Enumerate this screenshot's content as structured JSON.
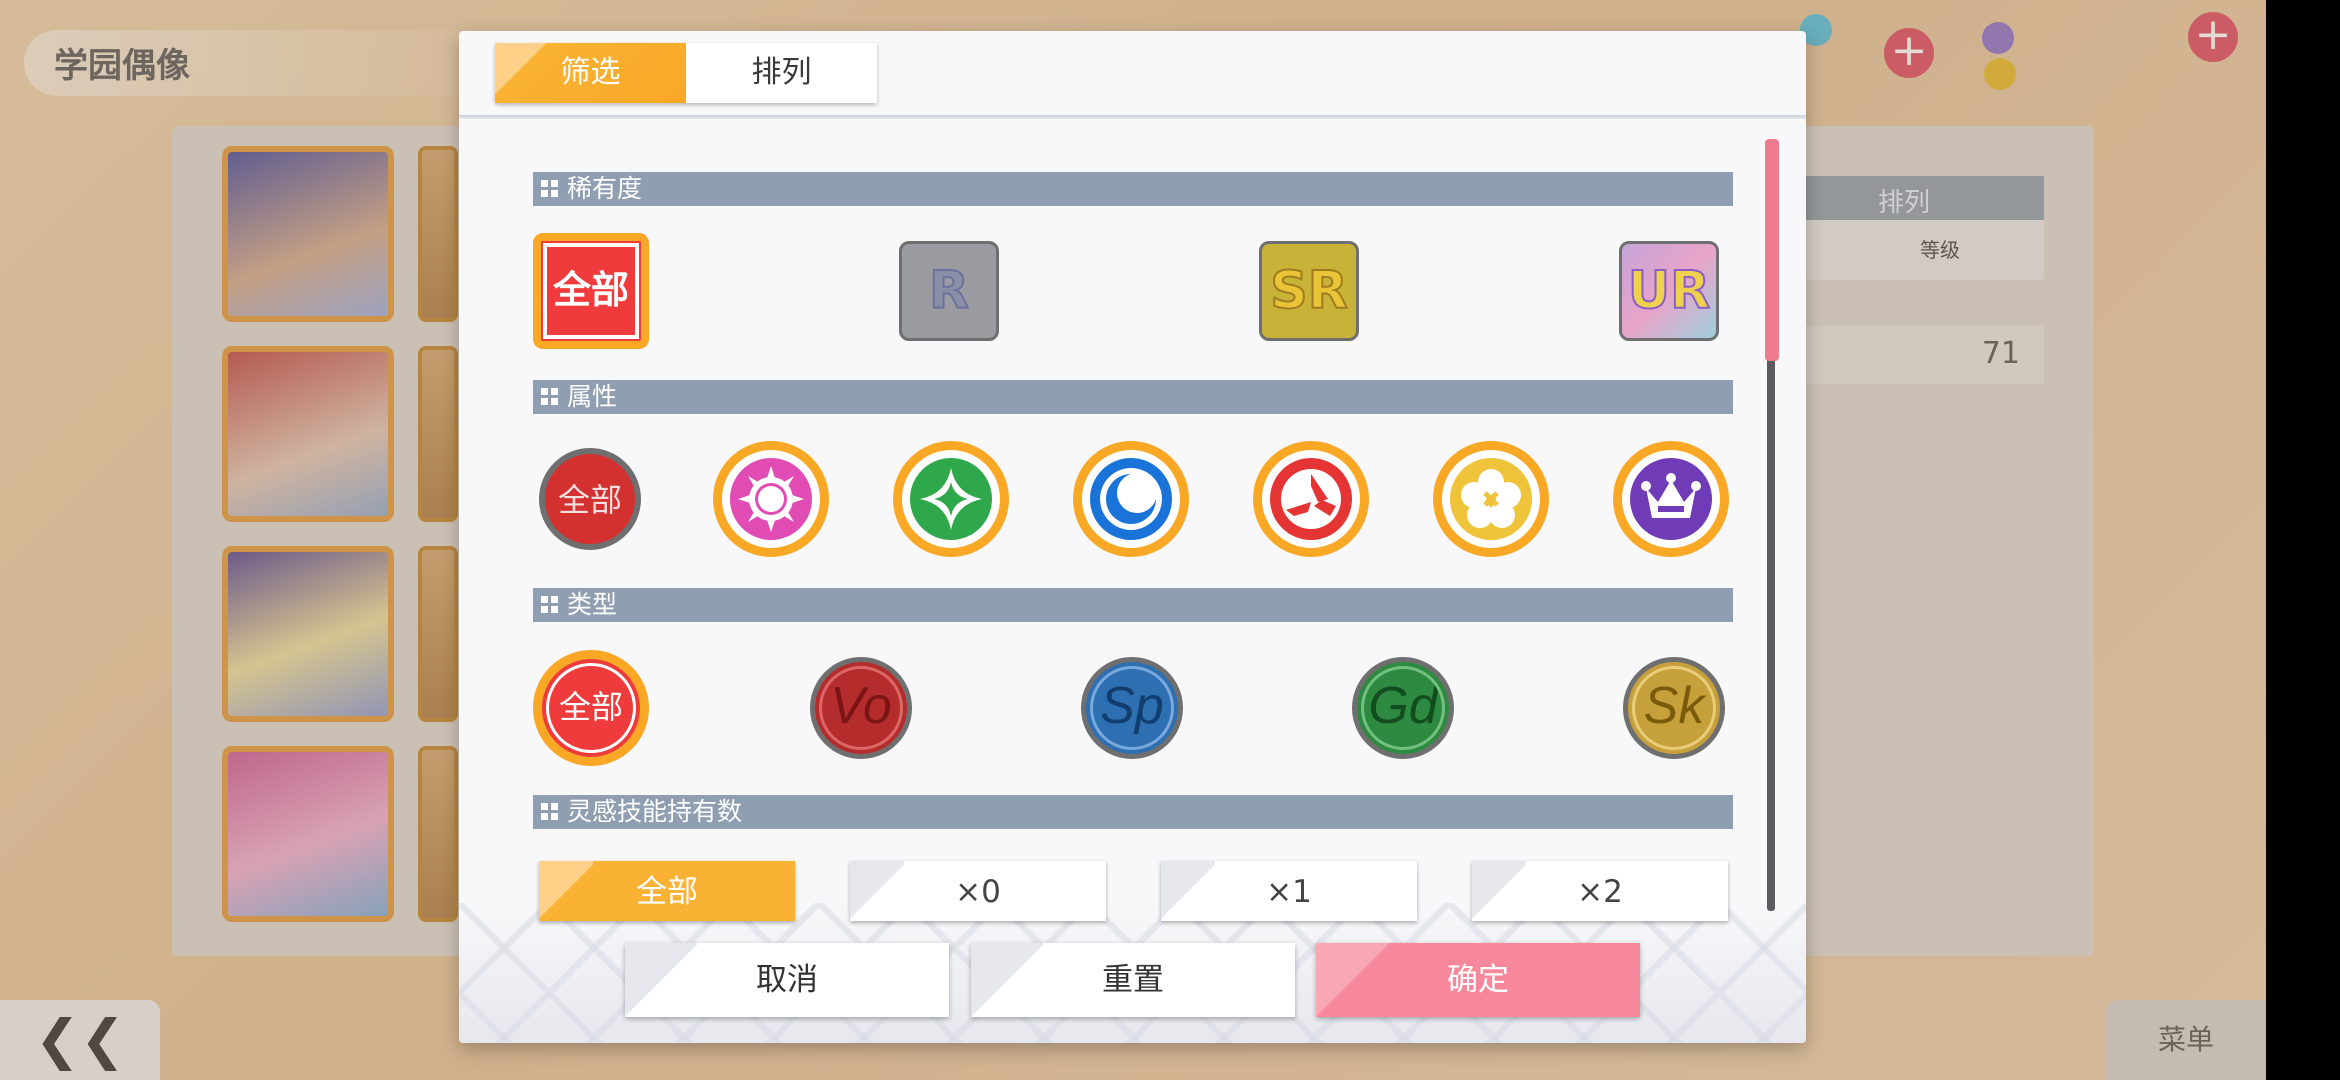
{
  "background": {
    "screen_title": "学园偶像",
    "table_header": "排列",
    "table_cell": "等级",
    "card_count": "71",
    "menu_label": "菜单",
    "back_glyph": "❮❮"
  },
  "dialog": {
    "tabs": [
      {
        "label": "筛选",
        "active": true
      },
      {
        "label": "排列",
        "active": false
      }
    ],
    "sections": {
      "rarity": {
        "title": "稀有度",
        "options": [
          {
            "label": "全部",
            "selected": true
          },
          {
            "label": "R"
          },
          {
            "label": "SR"
          },
          {
            "label": "UR"
          }
        ]
      },
      "attribute": {
        "title": "属性",
        "all_label": "全部",
        "icons": [
          "smile-icon",
          "pure-icon",
          "cool-icon",
          "active-icon",
          "natural-icon",
          "elegant-icon"
        ],
        "colors": [
          "#e04bb4",
          "#2ea84a",
          "#1a73d9",
          "#e53434",
          "#f0c43a",
          "#6f3bb6"
        ]
      },
      "type": {
        "title": "类型",
        "options": [
          {
            "label": "全部",
            "selected": true
          },
          {
            "label": "Vo",
            "color": "#b52c2c"
          },
          {
            "label": "Sp",
            "color": "#2e6fb2"
          },
          {
            "label": "Gd",
            "color": "#2e8a40"
          },
          {
            "label": "Sk",
            "color": "#c6a03a"
          }
        ]
      },
      "inspiration": {
        "title": "灵感技能持有数",
        "options": [
          {
            "label": "全部",
            "selected": true
          },
          {
            "label": "×0"
          },
          {
            "label": "×1"
          },
          {
            "label": "×2"
          }
        ]
      }
    },
    "footer": {
      "cancel": "取消",
      "reset": "重置",
      "confirm": "确定"
    }
  }
}
